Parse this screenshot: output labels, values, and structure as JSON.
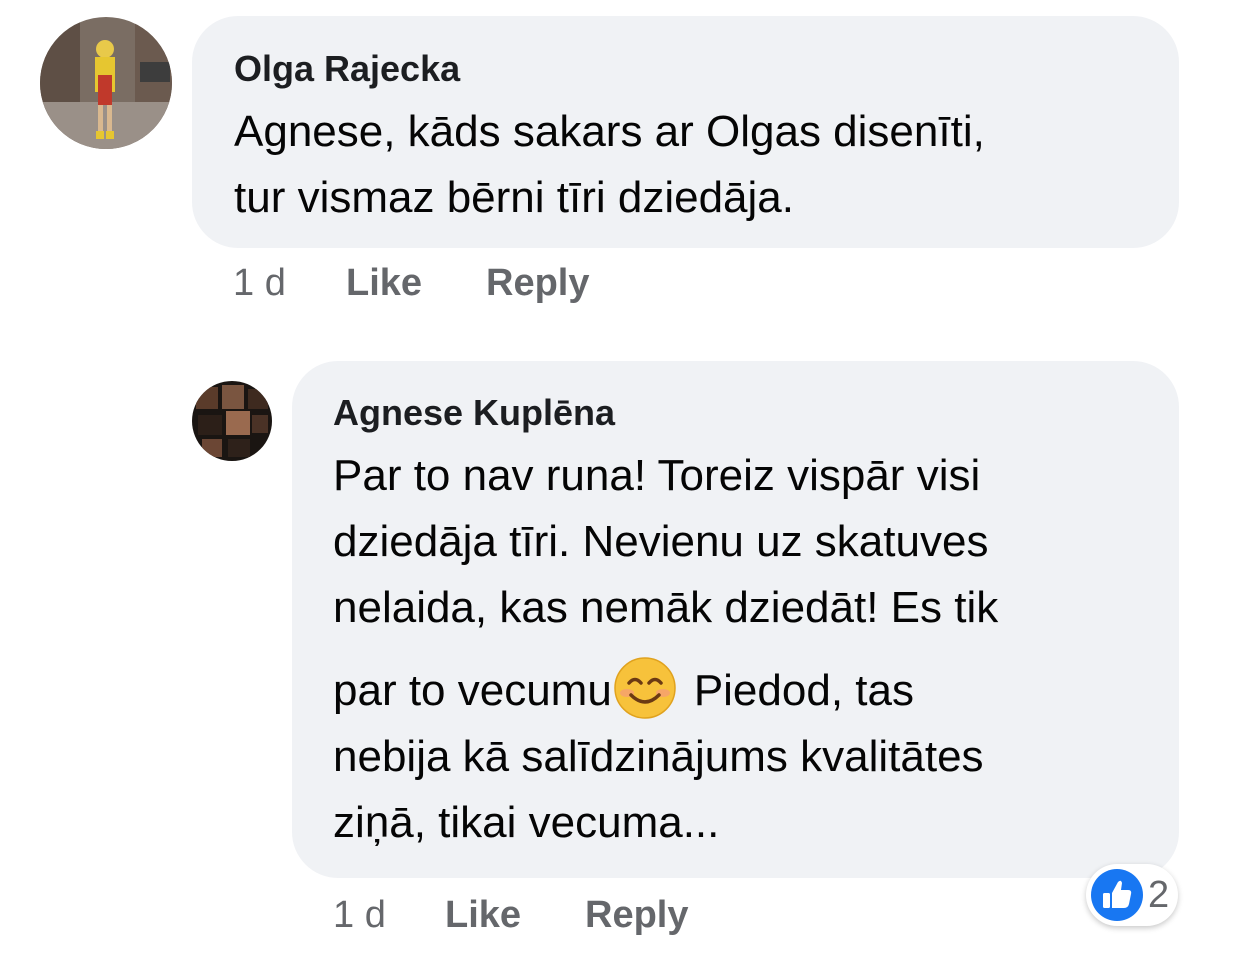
{
  "comments": [
    {
      "author": "Olga Rajecka",
      "lines": [
        "Agnese, kāds sakars ar Olgas disenīti,",
        "tur vismaz bērni tīri dziedāja."
      ],
      "time": "1 d",
      "like_label": "Like",
      "reply_label": "Reply"
    },
    {
      "author": "Agnese Kuplēna",
      "lines": [
        "Par to nav runa! Toreiz vispār visi",
        "dziedāja tīri. Nevienu uz skatuves",
        "nelaida, kas nemāk dziedāt! Es tik",
        "par to vecumu",
        "Piedod, tas",
        "nebija kā salīdzinājums kvalitātes",
        "ziņā, tikai vecuma..."
      ],
      "emoji": "smiling-face-icon",
      "time": "1 d",
      "like_label": "Like",
      "reply_label": "Reply",
      "reactions": {
        "icon": "thumbs-up-icon",
        "count": "2",
        "color": "#1877f2"
      }
    }
  ]
}
